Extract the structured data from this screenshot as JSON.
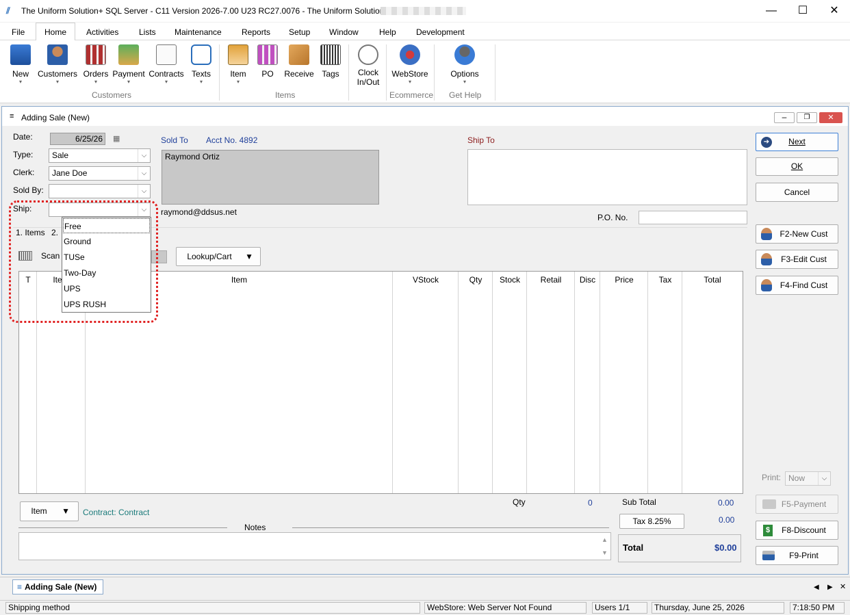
{
  "window": {
    "title": "The Uniform Solution+ SQL Server - C11 Version 2026-7.00 U23 RC27.0076 - The Uniform Solution",
    "minimize": "—",
    "maximize": "☐",
    "close": "✕"
  },
  "menu": [
    "File",
    "Home",
    "Activities",
    "Lists",
    "Maintenance",
    "Reports",
    "Setup",
    "Window",
    "Help",
    "Development"
  ],
  "ribbon": {
    "buttons": {
      "new": "New",
      "customers": "Customers",
      "orders": "Orders",
      "payment": "Payment",
      "contracts": "Contracts",
      "texts": "Texts",
      "item": "Item",
      "po": "PO",
      "receive": "Receive",
      "tags": "Tags",
      "clock1": "Clock",
      "clock2": "In/Out",
      "webstore": "WebStore",
      "options": "Options"
    },
    "groups": {
      "customers": "Customers",
      "items": "Items",
      "ecommerce": "Ecommerce",
      "gethelp": "Get Help"
    }
  },
  "sale": {
    "window_title": "Adding Sale  (New)",
    "date_label": "Date:",
    "date_value": "6/25/26",
    "type_label": "Type:",
    "type_value": "Sale",
    "clerk_label": "Clerk:",
    "clerk_value": "Jane Doe",
    "soldby_label": "Sold By:",
    "soldby_value": "",
    "ship_label": "Ship:",
    "ship_value": "",
    "sold_to_label": "Sold To",
    "acct_label": "Acct No. 4892",
    "customer_name": "Raymond Ortiz",
    "customer_email": "raymond@ddsus.net",
    "ship_to_label": "Ship To",
    "po_label": "P.O. No.",
    "tab_items": "1. Items",
    "tab_2": "2.",
    "scan_label": "Scan",
    "lookup_cart": "Lookup/Cart",
    "columns": [
      "T",
      "Item",
      "Item",
      "VStock",
      "Qty",
      "Stock",
      "Retail",
      "Disc",
      "Price",
      "Tax",
      "Total"
    ],
    "ship_options": [
      "Free",
      "Ground",
      "TUSe",
      "Two-Day",
      "UPS",
      "UPS RUSH"
    ],
    "item_btn": "Item",
    "contract_text": "Contract: Contract",
    "notes_label": "Notes",
    "qty_label": "Qty",
    "qty_value": "0",
    "subtotal_label": "Sub Total",
    "subtotal_value": "0.00",
    "tax_btn": "Tax  8.25%",
    "tax_value": "0.00",
    "total_label": "Total",
    "total_value": "$0.00"
  },
  "side": {
    "next": "Next",
    "ok": "OK",
    "cancel": "Cancel",
    "f2": "F2-New Cust",
    "f3": "F3-Edit Cust",
    "f4": "F4-Find Cust",
    "print_label": "Print:",
    "print_value": "Now",
    "f5": "F5-Payment",
    "f8": "F8-Discount",
    "f9": "F9-Print"
  },
  "taskbar": {
    "tab": "Adding Sale  (New)"
  },
  "status": {
    "hint": "Shipping method",
    "webstore": "WebStore: Web Server Not Found",
    "users": "Users 1/1",
    "date": "Thursday, June 25, 2026",
    "time": "7:18:50 PM"
  }
}
